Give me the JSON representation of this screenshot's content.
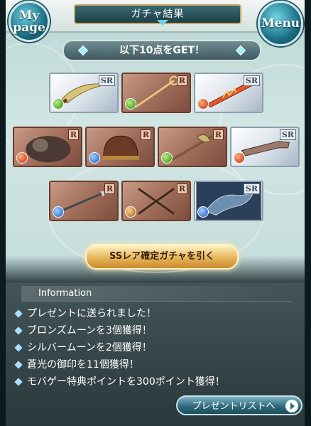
{
  "header": {
    "title": "ガチャ結果",
    "mypage_label_1": "My",
    "mypage_label_2": "page",
    "menu_label": "Menu"
  },
  "get_banner": "以下10点をGET！",
  "cards": [
    {
      "rarity": "SR",
      "element": "wind",
      "item": "curved-sword"
    },
    {
      "rarity": "R",
      "element": "wind",
      "item": "staff"
    },
    {
      "rarity": "SR",
      "element": "fire",
      "item": "flame-sword"
    },
    {
      "rarity": "R",
      "element": "fire",
      "item": "armored-beast"
    },
    {
      "rarity": "R",
      "element": "water",
      "item": "dome-helmet"
    },
    {
      "rarity": "R",
      "element": "wind",
      "item": "axe"
    },
    {
      "rarity": "SR",
      "element": "fire",
      "item": "rifle"
    },
    {
      "rarity": "R",
      "element": "water",
      "item": "spear"
    },
    {
      "rarity": "R",
      "element": "earth",
      "item": "swords"
    },
    {
      "rarity": "SR",
      "element": "water",
      "item": "dragon"
    }
  ],
  "ss_button": "SSレア確定ガチャを引く",
  "info": {
    "title": "Information",
    "items": [
      "プレゼントに送られました！",
      "ブロンズムーンを3個獲得！",
      "シルバームーンを2個獲得！",
      "蒼光の御印を11個獲得！",
      "モバゲー特典ポイントを300ポイント獲得！"
    ],
    "present_button": "プレゼントリストへ"
  }
}
